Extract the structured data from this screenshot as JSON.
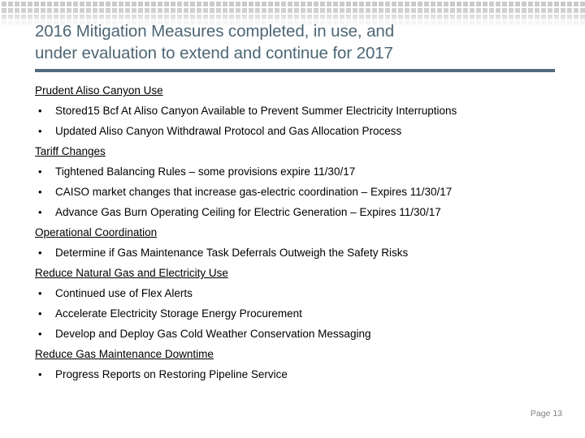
{
  "slide": {
    "title_lines": [
      "2016 Mitigation Measures completed, in use, and",
      "under evaluation to extend and continue for 2017"
    ],
    "title_color": "#4d6676",
    "rule_color": "#4f6b7d",
    "body_color": "#000000",
    "page_label": "Page 13",
    "page_label_color": "#808080",
    "bullet_glyph": "•",
    "sections": [
      {
        "heading": "Prudent Aliso Canyon Use",
        "bullets": [
          "Stored15 Bcf At Aliso Canyon Available to Prevent Summer Electricity Interruptions",
          "Updated Aliso Canyon Withdrawal Protocol and Gas Allocation Process"
        ]
      },
      {
        "heading": "Tariff Changes",
        "bullets": [
          "Tightened Balancing Rules – some provisions expire 11/30/17",
          "CAISO market changes that increase gas-electric coordination – Expires 11/30/17",
          "Advance Gas Burn Operating Ceiling for Electric Generation – Expires 11/30/17"
        ]
      },
      {
        "heading": "Operational Coordination",
        "bullets": [
          "Determine if Gas Maintenance Task Deferrals Outweigh the Safety Risks"
        ]
      },
      {
        "heading": "Reduce Natural Gas and Electricity Use",
        "bullets": [
          "Continued use of Flex Alerts",
          "Accelerate Electricity Storage Energy Procurement",
          "Develop and Deploy Gas Cold Weather Conservation Messaging"
        ]
      },
      {
        "heading": "Reduce Gas Maintenance Downtime",
        "bullets": [
          "Progress Reports on Restoring Pipeline Service"
        ]
      }
    ]
  }
}
